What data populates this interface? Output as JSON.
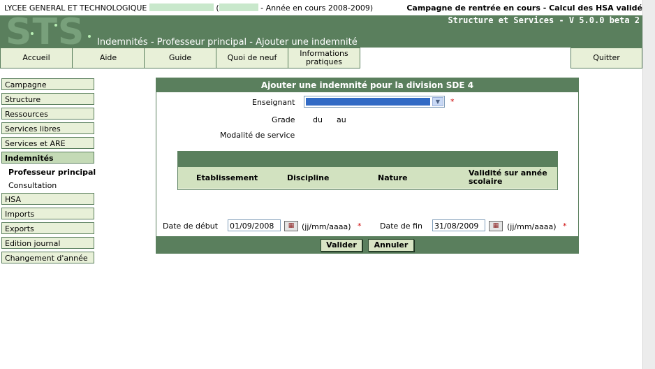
{
  "header": {
    "school_prefix": "LYCEE GENERAL ET TECHNOLOGIQUE",
    "open_paren": "(",
    "year_text": "- Année en cours 2008-2009)",
    "campaign": "Campagne de rentrée en cours - Calcul des HSA validé",
    "version": "Structure et Services - V 5.0.0 beta 2",
    "logo_text": "STS",
    "page_title": "Indemnités - Professeur principal - Ajouter une indemnité"
  },
  "menu": {
    "accueil": "Accueil",
    "aide": "Aide",
    "guide": "Guide",
    "quoi_de_neuf": "Quoi de neuf",
    "info_line1": "Informations",
    "info_line2": "pratiques",
    "quitter": "Quitter"
  },
  "sidebar": {
    "items": [
      "Campagne",
      "Structure",
      "Ressources",
      "Services libres",
      "Services et ARE",
      "Indemnités"
    ],
    "sub": [
      "Professeur principal",
      "Consultation"
    ],
    "items_after": [
      "HSA",
      "Imports",
      "Exports",
      "Edition journal",
      "Changement d'année"
    ]
  },
  "form": {
    "title": "Ajouter une indemnité pour la division SDE 4",
    "enseignant_label": "Enseignant",
    "required_mark": "*",
    "grade_label": "Grade",
    "du_label": "du",
    "au_label": "au",
    "modalite_label": "Modalité de service",
    "table_headers": [
      "Etablissement",
      "Discipline",
      "Nature",
      "Validité sur année scolaire"
    ],
    "date_debut_label": "Date de début",
    "date_debut_value": "01/09/2008",
    "date_fin_label": "Date de fin",
    "date_fin_value": "31/08/2009",
    "date_format": "(jj/mm/aaaa)",
    "valider": "Valider",
    "annuler": "Annuler"
  },
  "colors": {
    "brand_green": "#5a7f5d",
    "tab_bg": "#e8f0d8",
    "selection_blue": "#316ac5",
    "required_red": "#cc0000"
  }
}
